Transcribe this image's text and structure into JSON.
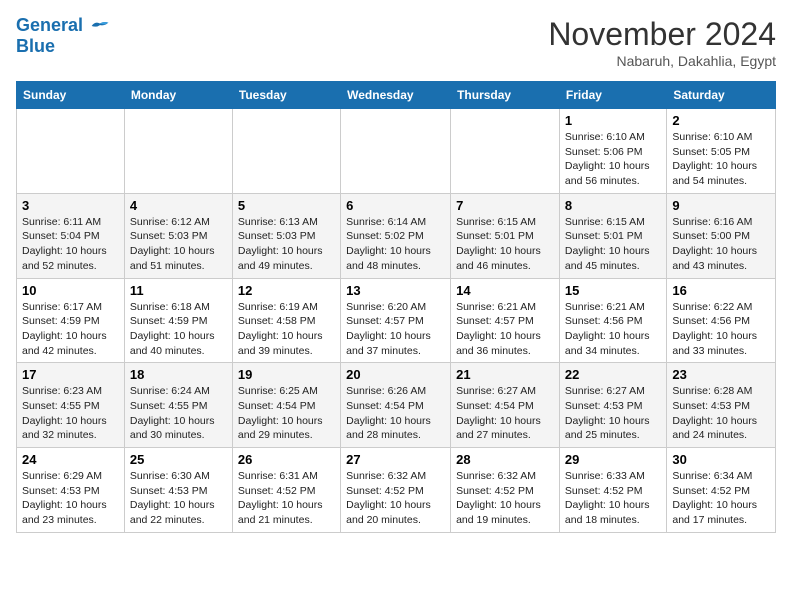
{
  "header": {
    "logo_line1": "General",
    "logo_line2": "Blue",
    "month": "November 2024",
    "location": "Nabaruh, Dakahlia, Egypt"
  },
  "weekdays": [
    "Sunday",
    "Monday",
    "Tuesday",
    "Wednesday",
    "Thursday",
    "Friday",
    "Saturday"
  ],
  "weeks": [
    [
      {
        "day": "",
        "info": ""
      },
      {
        "day": "",
        "info": ""
      },
      {
        "day": "",
        "info": ""
      },
      {
        "day": "",
        "info": ""
      },
      {
        "day": "",
        "info": ""
      },
      {
        "day": "1",
        "info": "Sunrise: 6:10 AM\nSunset: 5:06 PM\nDaylight: 10 hours\nand 56 minutes."
      },
      {
        "day": "2",
        "info": "Sunrise: 6:10 AM\nSunset: 5:05 PM\nDaylight: 10 hours\nand 54 minutes."
      }
    ],
    [
      {
        "day": "3",
        "info": "Sunrise: 6:11 AM\nSunset: 5:04 PM\nDaylight: 10 hours\nand 52 minutes."
      },
      {
        "day": "4",
        "info": "Sunrise: 6:12 AM\nSunset: 5:03 PM\nDaylight: 10 hours\nand 51 minutes."
      },
      {
        "day": "5",
        "info": "Sunrise: 6:13 AM\nSunset: 5:03 PM\nDaylight: 10 hours\nand 49 minutes."
      },
      {
        "day": "6",
        "info": "Sunrise: 6:14 AM\nSunset: 5:02 PM\nDaylight: 10 hours\nand 48 minutes."
      },
      {
        "day": "7",
        "info": "Sunrise: 6:15 AM\nSunset: 5:01 PM\nDaylight: 10 hours\nand 46 minutes."
      },
      {
        "day": "8",
        "info": "Sunrise: 6:15 AM\nSunset: 5:01 PM\nDaylight: 10 hours\nand 45 minutes."
      },
      {
        "day": "9",
        "info": "Sunrise: 6:16 AM\nSunset: 5:00 PM\nDaylight: 10 hours\nand 43 minutes."
      }
    ],
    [
      {
        "day": "10",
        "info": "Sunrise: 6:17 AM\nSunset: 4:59 PM\nDaylight: 10 hours\nand 42 minutes."
      },
      {
        "day": "11",
        "info": "Sunrise: 6:18 AM\nSunset: 4:59 PM\nDaylight: 10 hours\nand 40 minutes."
      },
      {
        "day": "12",
        "info": "Sunrise: 6:19 AM\nSunset: 4:58 PM\nDaylight: 10 hours\nand 39 minutes."
      },
      {
        "day": "13",
        "info": "Sunrise: 6:20 AM\nSunset: 4:57 PM\nDaylight: 10 hours\nand 37 minutes."
      },
      {
        "day": "14",
        "info": "Sunrise: 6:21 AM\nSunset: 4:57 PM\nDaylight: 10 hours\nand 36 minutes."
      },
      {
        "day": "15",
        "info": "Sunrise: 6:21 AM\nSunset: 4:56 PM\nDaylight: 10 hours\nand 34 minutes."
      },
      {
        "day": "16",
        "info": "Sunrise: 6:22 AM\nSunset: 4:56 PM\nDaylight: 10 hours\nand 33 minutes."
      }
    ],
    [
      {
        "day": "17",
        "info": "Sunrise: 6:23 AM\nSunset: 4:55 PM\nDaylight: 10 hours\nand 32 minutes."
      },
      {
        "day": "18",
        "info": "Sunrise: 6:24 AM\nSunset: 4:55 PM\nDaylight: 10 hours\nand 30 minutes."
      },
      {
        "day": "19",
        "info": "Sunrise: 6:25 AM\nSunset: 4:54 PM\nDaylight: 10 hours\nand 29 minutes."
      },
      {
        "day": "20",
        "info": "Sunrise: 6:26 AM\nSunset: 4:54 PM\nDaylight: 10 hours\nand 28 minutes."
      },
      {
        "day": "21",
        "info": "Sunrise: 6:27 AM\nSunset: 4:54 PM\nDaylight: 10 hours\nand 27 minutes."
      },
      {
        "day": "22",
        "info": "Sunrise: 6:27 AM\nSunset: 4:53 PM\nDaylight: 10 hours\nand 25 minutes."
      },
      {
        "day": "23",
        "info": "Sunrise: 6:28 AM\nSunset: 4:53 PM\nDaylight: 10 hours\nand 24 minutes."
      }
    ],
    [
      {
        "day": "24",
        "info": "Sunrise: 6:29 AM\nSunset: 4:53 PM\nDaylight: 10 hours\nand 23 minutes."
      },
      {
        "day": "25",
        "info": "Sunrise: 6:30 AM\nSunset: 4:53 PM\nDaylight: 10 hours\nand 22 minutes."
      },
      {
        "day": "26",
        "info": "Sunrise: 6:31 AM\nSunset: 4:52 PM\nDaylight: 10 hours\nand 21 minutes."
      },
      {
        "day": "27",
        "info": "Sunrise: 6:32 AM\nSunset: 4:52 PM\nDaylight: 10 hours\nand 20 minutes."
      },
      {
        "day": "28",
        "info": "Sunrise: 6:32 AM\nSunset: 4:52 PM\nDaylight: 10 hours\nand 19 minutes."
      },
      {
        "day": "29",
        "info": "Sunrise: 6:33 AM\nSunset: 4:52 PM\nDaylight: 10 hours\nand 18 minutes."
      },
      {
        "day": "30",
        "info": "Sunrise: 6:34 AM\nSunset: 4:52 PM\nDaylight: 10 hours\nand 17 minutes."
      }
    ]
  ]
}
